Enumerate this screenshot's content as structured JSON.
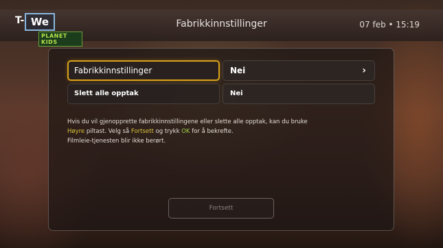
{
  "header": {
    "title": "Fabrikkinnstillinger",
    "datetime": "07 feb • 15:19",
    "logo": {
      "t": "T-",
      "we": "We",
      "channel": "PLANET KIDS"
    }
  },
  "settings": {
    "rows": [
      {
        "label": "Fabrikkinnstillinger",
        "value": "Nei",
        "chevron": "›",
        "focused": true
      },
      {
        "label": "Slett alle opptak",
        "value": "Nei",
        "focused": false
      }
    ]
  },
  "info": {
    "line1": "Hvis du vil gjenopprette fabrikkinnstillingene eller slette alle opptak, kan du bruke",
    "line2_highlight": "Høyre",
    "line2_a": " piltast. Velg så ",
    "line2_fortsett": "Fortsett",
    "line2_b": " og trykk ",
    "line2_ok": "OK",
    "line2_c": " for å bekrefte.",
    "line3": "Filmleie-tjenesten blir ikke berørt."
  },
  "actions": {
    "continue_label": "Fortsett"
  },
  "colors": {
    "focus": "#d9a21a",
    "highlight_yellow": "#d9c33a",
    "highlight_green": "#9fd04a"
  },
  "icons": {
    "chevron": "chevron-right-icon"
  }
}
